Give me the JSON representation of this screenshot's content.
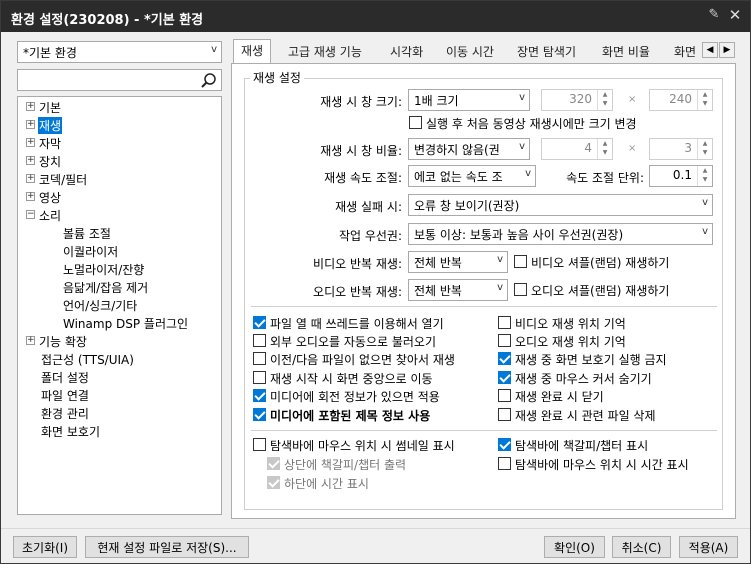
{
  "window": {
    "title": "환경 설정(230208) - *기본 환경"
  },
  "profile_select": {
    "value": "*기본 환경"
  },
  "tree": [
    {
      "label": "기본",
      "toggle": "+"
    },
    {
      "label": "재생",
      "toggle": "+"
    },
    {
      "label": "자막",
      "toggle": "+"
    },
    {
      "label": "장치",
      "toggle": "+"
    },
    {
      "label": "코덱/필터",
      "toggle": "+"
    },
    {
      "label": "영상",
      "toggle": "+"
    },
    {
      "label": "소리",
      "toggle": "−"
    },
    {
      "label": "볼륨 조절"
    },
    {
      "label": "이퀄라이저"
    },
    {
      "label": "노멀라이저/잔향"
    },
    {
      "label": "음닮게/잡음 제거"
    },
    {
      "label": "언어/싱크/기타"
    },
    {
      "label": "Winamp DSP 플러그인"
    },
    {
      "label": "기능 확장",
      "toggle": "+"
    },
    {
      "label": "접근성 (TTS/UIA)"
    },
    {
      "label": "폴더 설정"
    },
    {
      "label": "파일 연결"
    },
    {
      "label": "환경 관리"
    },
    {
      "label": "화면 보호기"
    }
  ],
  "tabs": [
    "재생",
    "고급 재생 기능",
    "시각화",
    "이동 시간",
    "장면 탐색기",
    "화면 비율",
    "화면"
  ],
  "group_title": "재생 설정",
  "settings": {
    "window_size": {
      "label": "재생 시 창 크기:",
      "value": "1배 크기",
      "w": "320",
      "h": "240"
    },
    "first_only": "실행 후 처음 동영상 재생시에만 크기 변경",
    "window_ratio": {
      "label": "재생 시 창 비율:",
      "value": "변경하지 않음(권",
      "w": "4",
      "h": "3"
    },
    "speed": {
      "label": "재생 속도 조절:",
      "value": "에코 없는 속도 조",
      "unit_label": "속도 조절 단위:",
      "unit": "0.1"
    },
    "fail": {
      "label": "재생 실패 시:",
      "value": "오류 창 보이기(권장)"
    },
    "priority": {
      "label": "작업 우선권:",
      "value": "보통 이상: 보통과 높음 사이 우선권(권장)"
    },
    "video_repeat": {
      "label": "비디오 반복 재생:",
      "value": "전체 반복",
      "shuffle": "비디오 셔플(랜덤) 재생하기"
    },
    "audio_repeat": {
      "label": "오디오 반복 재생:",
      "value": "전체 반복",
      "shuffle": "오디오 셔플(랜덤) 재생하기"
    },
    "times_sep": "×"
  },
  "checks_left": [
    {
      "label": "파일 열 때 쓰레드를 이용해서 열기",
      "checked": true
    },
    {
      "label": "외부 오디오를 자동으로 불러오기",
      "checked": false
    },
    {
      "label": "이전/다음 파일이 없으면 찾아서 재생",
      "checked": false
    },
    {
      "label": "재생 시작 시 화면 중앙으로 이동",
      "checked": false
    },
    {
      "label": "미디어에 회전 정보가 있으면 적용",
      "checked": true
    },
    {
      "label": "미디어에 포함된 제목 정보 사용",
      "checked": true
    }
  ],
  "checks_right": [
    {
      "label": "비디오 재생 위치 기억",
      "checked": false
    },
    {
      "label": "오디오 재생 위치 기억",
      "checked": false
    },
    {
      "label": "재생 중 화면 보호기 실행 금지",
      "checked": true
    },
    {
      "label": "재생 중 마우스 커서 숨기기",
      "checked": true
    },
    {
      "label": "재생 완료 시 닫기",
      "checked": false
    },
    {
      "label": "재생 완료 시 관련 파일 삭제",
      "checked": false
    }
  ],
  "seek": {
    "thumb": "탐색바에 마우스 위치 시 썸네일 표시",
    "top_bookmark": "상단에 책갈피/챕터 출력",
    "bottom_time": "하단에 시간 표시",
    "bookmark": "탐색바에 책갈피/챕터 표시",
    "time": "탐색바에 마우스 위치 시 시간 표시"
  },
  "buttons": {
    "reset": "초기화(I)",
    "save": "현재 설정 파일로 저장(S)...",
    "ok": "확인(O)",
    "cancel": "취소(C)",
    "apply": "적용(A)"
  }
}
